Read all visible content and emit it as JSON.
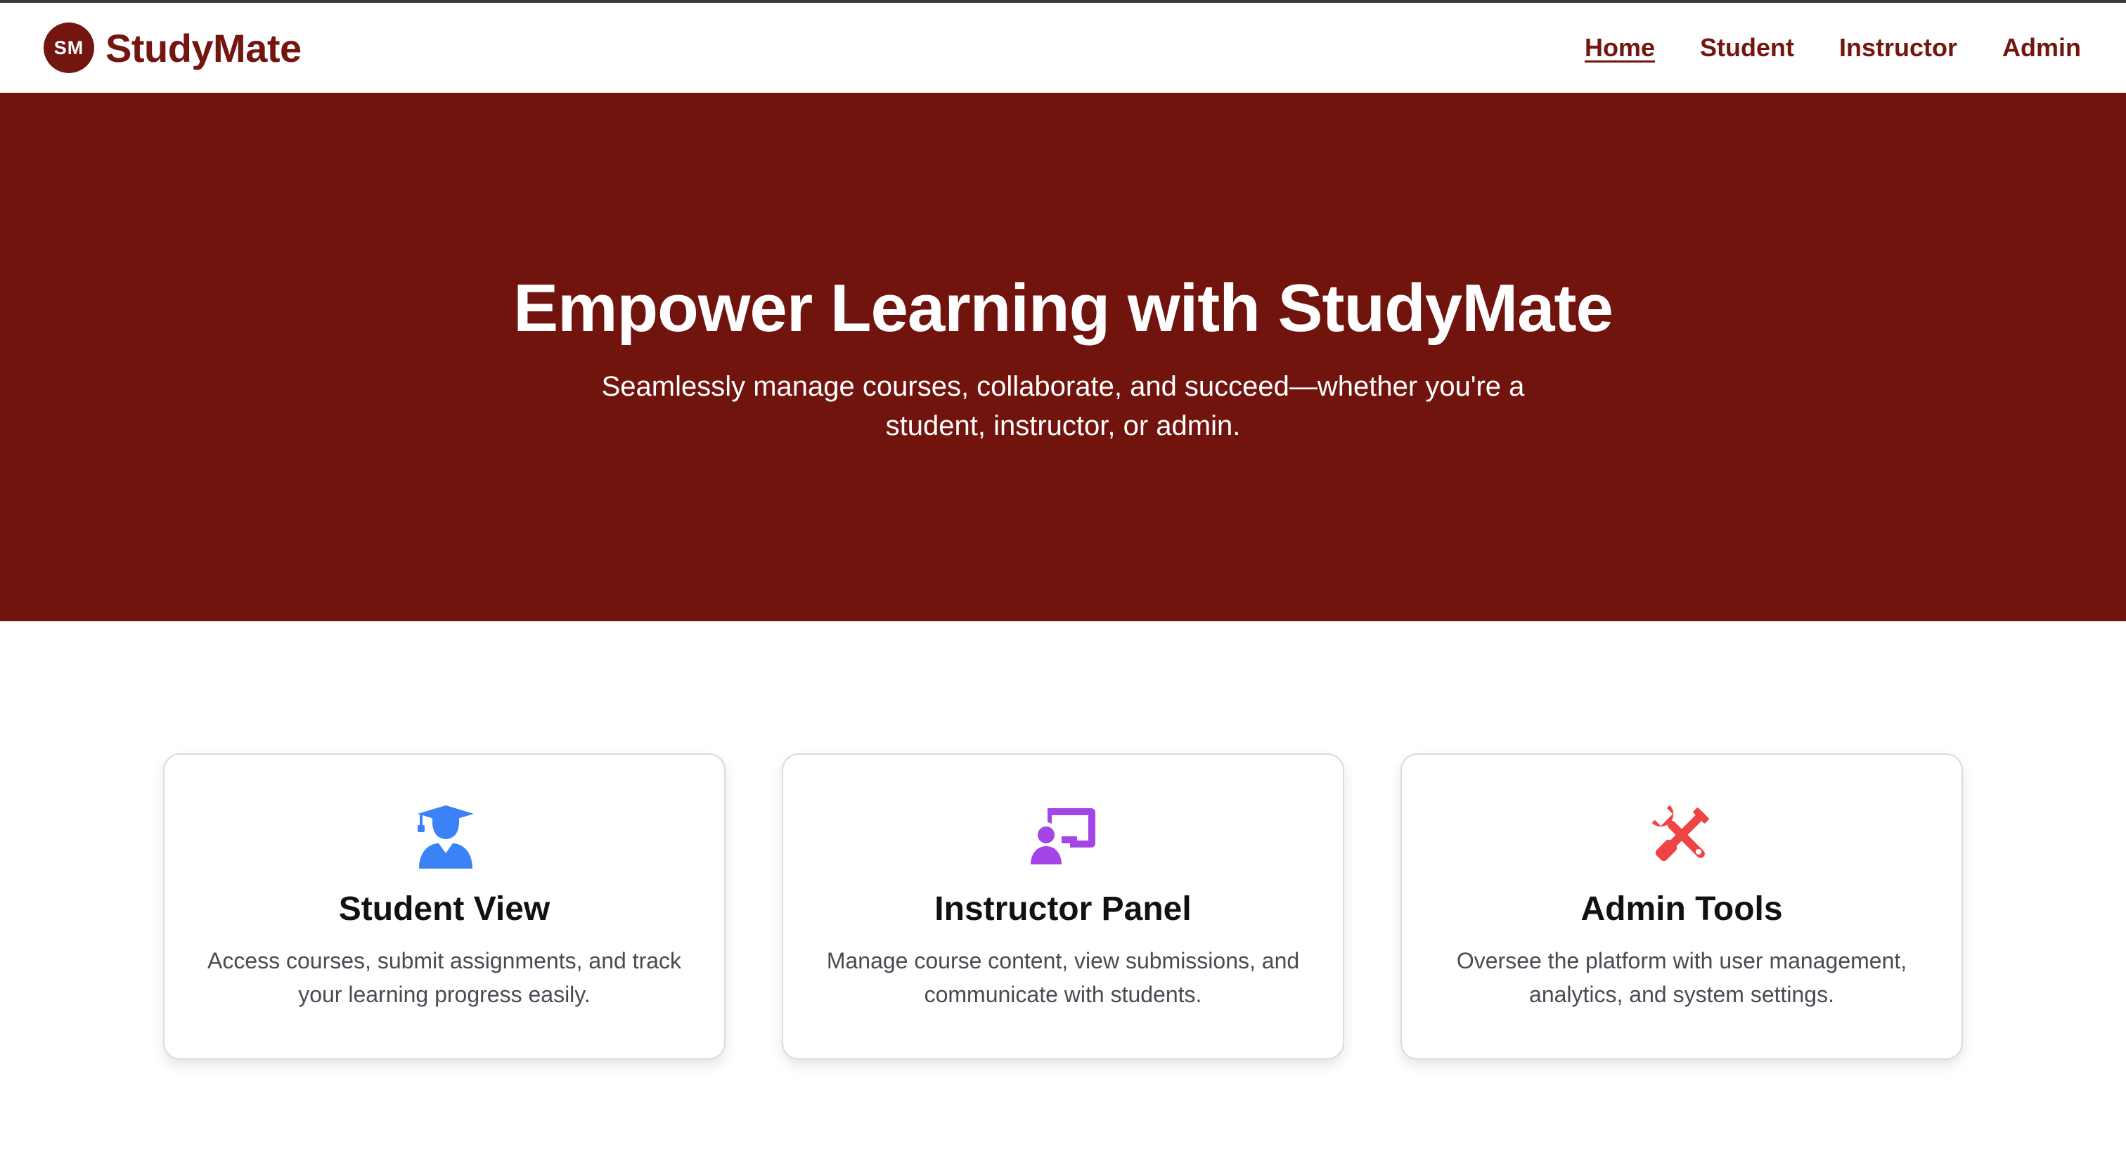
{
  "brand": {
    "badge": "SM",
    "name": "StudyMate"
  },
  "nav": {
    "items": [
      {
        "label": "Home",
        "active": true
      },
      {
        "label": "Student"
      },
      {
        "label": "Instructor"
      },
      {
        "label": "Admin"
      }
    ]
  },
  "hero": {
    "title": "Empower Learning with StudyMate",
    "subtitle": "Seamlessly manage courses, collaborate, and succeed—whether you're a student, instructor, or admin."
  },
  "cards": [
    {
      "icon": "graduate-icon",
      "title": "Student View",
      "description": "Access courses, submit assignments, and track your learning progress easily."
    },
    {
      "icon": "chalkboard-teacher-icon",
      "title": "Instructor Panel",
      "description": "Manage course content, view submissions, and communicate with students."
    },
    {
      "icon": "tools-icon",
      "title": "Admin Tools",
      "description": "Oversee the platform with user management, analytics, and system settings."
    }
  ],
  "colors": {
    "brand": "#731610",
    "hero_bg": "#71140e",
    "student_icon": "#3b82f6",
    "instructor_icon": "#a445e8",
    "admin_icon": "#ef4444"
  }
}
